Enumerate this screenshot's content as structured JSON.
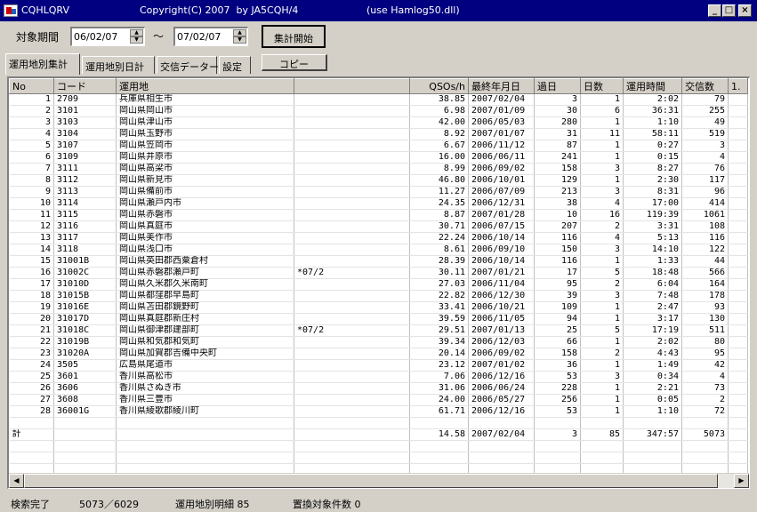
{
  "window": {
    "title": "CQHLQRV",
    "copyright": "Copyright(C) 2007  by JA5CQH/4",
    "note": "(use Hamlog50.dll)"
  },
  "period": {
    "label": "対象期間",
    "from": "06/02/07",
    "tilde": "〜",
    "to": "07/02/07",
    "start_button": "集計開始"
  },
  "tabs": [
    "運用地別集計",
    "運用地別日計",
    "交信データー",
    "設定"
  ],
  "copy_button": "コピー",
  "columns": [
    "No",
    "コード",
    "運用地",
    "QSOs/h",
    "最終年月日",
    "過日",
    "日数",
    "運用時間",
    "交信数",
    "1."
  ],
  "rows": [
    [
      "1",
      "2709",
      "兵庫県相生市",
      "",
      "38.85",
      "2007/02/04",
      "3",
      "1",
      "2:02",
      "79"
    ],
    [
      "2",
      "3101",
      "岡山県岡山市",
      "",
      "6.98",
      "2007/01/09",
      "30",
      "6",
      "36:31",
      "255"
    ],
    [
      "3",
      "3103",
      "岡山県津山市",
      "",
      "42.00",
      "2006/05/03",
      "280",
      "1",
      "1:10",
      "49"
    ],
    [
      "4",
      "3104",
      "岡山県玉野市",
      "",
      "8.92",
      "2007/01/07",
      "31",
      "11",
      "58:11",
      "519"
    ],
    [
      "5",
      "3107",
      "岡山県笠岡市",
      "",
      "6.67",
      "2006/11/12",
      "87",
      "1",
      "0:27",
      "3"
    ],
    [
      "6",
      "3109",
      "岡山県井原市",
      "",
      "16.00",
      "2006/06/11",
      "241",
      "1",
      "0:15",
      "4"
    ],
    [
      "7",
      "3111",
      "岡山県高梁市",
      "",
      "8.99",
      "2006/09/02",
      "158",
      "3",
      "8:27",
      "76"
    ],
    [
      "8",
      "3112",
      "岡山県新見市",
      "",
      "46.80",
      "2006/10/01",
      "129",
      "1",
      "2:30",
      "117"
    ],
    [
      "9",
      "3113",
      "岡山県備前市",
      "",
      "11.27",
      "2006/07/09",
      "213",
      "3",
      "8:31",
      "96"
    ],
    [
      "10",
      "3114",
      "岡山県瀬戸内市",
      "",
      "24.35",
      "2006/12/31",
      "38",
      "4",
      "17:00",
      "414"
    ],
    [
      "11",
      "3115",
      "岡山県赤磐市",
      "",
      "8.87",
      "2007/01/28",
      "10",
      "16",
      "119:39",
      "1061"
    ],
    [
      "12",
      "3116",
      "岡山県真庭市",
      "",
      "30.71",
      "2006/07/15",
      "207",
      "2",
      "3:31",
      "108"
    ],
    [
      "13",
      "3117",
      "岡山県美作市",
      "",
      "22.24",
      "2006/10/14",
      "116",
      "4",
      "5:13",
      "116"
    ],
    [
      "14",
      "3118",
      "岡山県浅口市",
      "",
      "8.61",
      "2006/09/10",
      "150",
      "3",
      "14:10",
      "122"
    ],
    [
      "15",
      "31001B",
      "岡山県英田郡西粟倉村",
      "",
      "28.39",
      "2006/10/14",
      "116",
      "1",
      "1:33",
      "44"
    ],
    [
      "16",
      "31002C",
      "岡山県赤磐郡瀬戸町",
      "*07/2",
      "30.11",
      "2007/01/21",
      "17",
      "5",
      "18:48",
      "566"
    ],
    [
      "17",
      "31010D",
      "岡山県久米郡久米南町",
      "",
      "27.03",
      "2006/11/04",
      "95",
      "2",
      "6:04",
      "164"
    ],
    [
      "18",
      "31015B",
      "岡山県都窪郡早島町",
      "",
      "22.82",
      "2006/12/30",
      "39",
      "3",
      "7:48",
      "178"
    ],
    [
      "19",
      "31016E",
      "岡山県苫田郡鏡野町",
      "",
      "33.41",
      "2006/10/21",
      "109",
      "1",
      "2:47",
      "93"
    ],
    [
      "20",
      "31017D",
      "岡山県真庭郡新庄村",
      "",
      "39.59",
      "2006/11/05",
      "94",
      "1",
      "3:17",
      "130"
    ],
    [
      "21",
      "31018C",
      "岡山県御津郡建部町",
      "*07/2",
      "29.51",
      "2007/01/13",
      "25",
      "5",
      "17:19",
      "511"
    ],
    [
      "22",
      "31019B",
      "岡山県和気郡和気町",
      "",
      "39.34",
      "2006/12/03",
      "66",
      "1",
      "2:02",
      "80"
    ],
    [
      "23",
      "31020A",
      "岡山県加賀郡吉備中央町",
      "",
      "20.14",
      "2006/09/02",
      "158",
      "2",
      "4:43",
      "95"
    ],
    [
      "24",
      "3505",
      "広島県尾道市",
      "",
      "23.12",
      "2007/01/02",
      "36",
      "1",
      "1:49",
      "42"
    ],
    [
      "25",
      "3601",
      "香川県高松市",
      "",
      "7.06",
      "2006/12/16",
      "53",
      "3",
      "0:34",
      "4"
    ],
    [
      "26",
      "3606",
      "香川県さぬき市",
      "",
      "31.06",
      "2006/06/24",
      "228",
      "1",
      "2:21",
      "73"
    ],
    [
      "27",
      "3608",
      "香川県三豊市",
      "",
      "24.00",
      "2006/05/27",
      "256",
      "1",
      "0:05",
      "2"
    ],
    [
      "28",
      "36001G",
      "香川県綾歌郡綾川町",
      "",
      "61.71",
      "2006/12/16",
      "53",
      "1",
      "1:10",
      "72"
    ]
  ],
  "total": {
    "label": "計",
    "qsos_h": "14.58",
    "last_date": "2007/02/04",
    "days_ago": "3",
    "days": "85",
    "op_time": "347:57",
    "qsos": "5073"
  },
  "status": {
    "state": "検索完了",
    "count": "5073／6029",
    "detail": "運用地別明細 85",
    "replace": "置換対象件数 0"
  },
  "colors": {
    "titlebar": "#000080",
    "face": "#d4d0c8",
    "grid_bg": "#ffffff"
  },
  "icons": [
    "app-icon",
    "minimize-icon",
    "maximize-icon",
    "close-icon",
    "spin-up-icon",
    "spin-down-icon",
    "scroll-left-icon",
    "scroll-right-icon"
  ]
}
